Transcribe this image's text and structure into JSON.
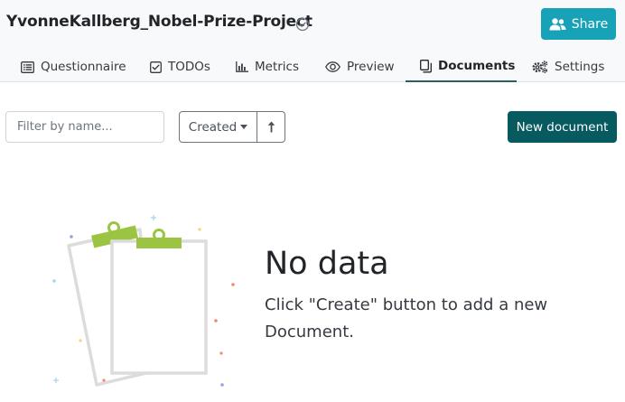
{
  "header": {
    "project_title": "YvonneKallberg_Nobel-Prize-Project",
    "share_label": "Share"
  },
  "tabs": [
    {
      "label": "Questionnaire",
      "icon": "list-icon"
    },
    {
      "label": "TODOs",
      "icon": "checkbox-icon"
    },
    {
      "label": "Metrics",
      "icon": "bar-chart-icon"
    },
    {
      "label": "Preview",
      "icon": "eye-icon"
    },
    {
      "label": "Documents",
      "icon": "documents-icon",
      "active": true
    },
    {
      "label": "Settings",
      "icon": "gears-icon"
    }
  ],
  "toolbar": {
    "filter_placeholder": "Filter by name...",
    "sort_label": "Created",
    "new_document_label": "New document"
  },
  "empty_state": {
    "title": "No data",
    "description": "Click \"Create\" button to add a new Document."
  },
  "colors": {
    "share_button": "#17a2b8",
    "primary_button": "#075a5f",
    "active_tab_underline": "#2c5e63",
    "clip_green": "#9cc443"
  }
}
